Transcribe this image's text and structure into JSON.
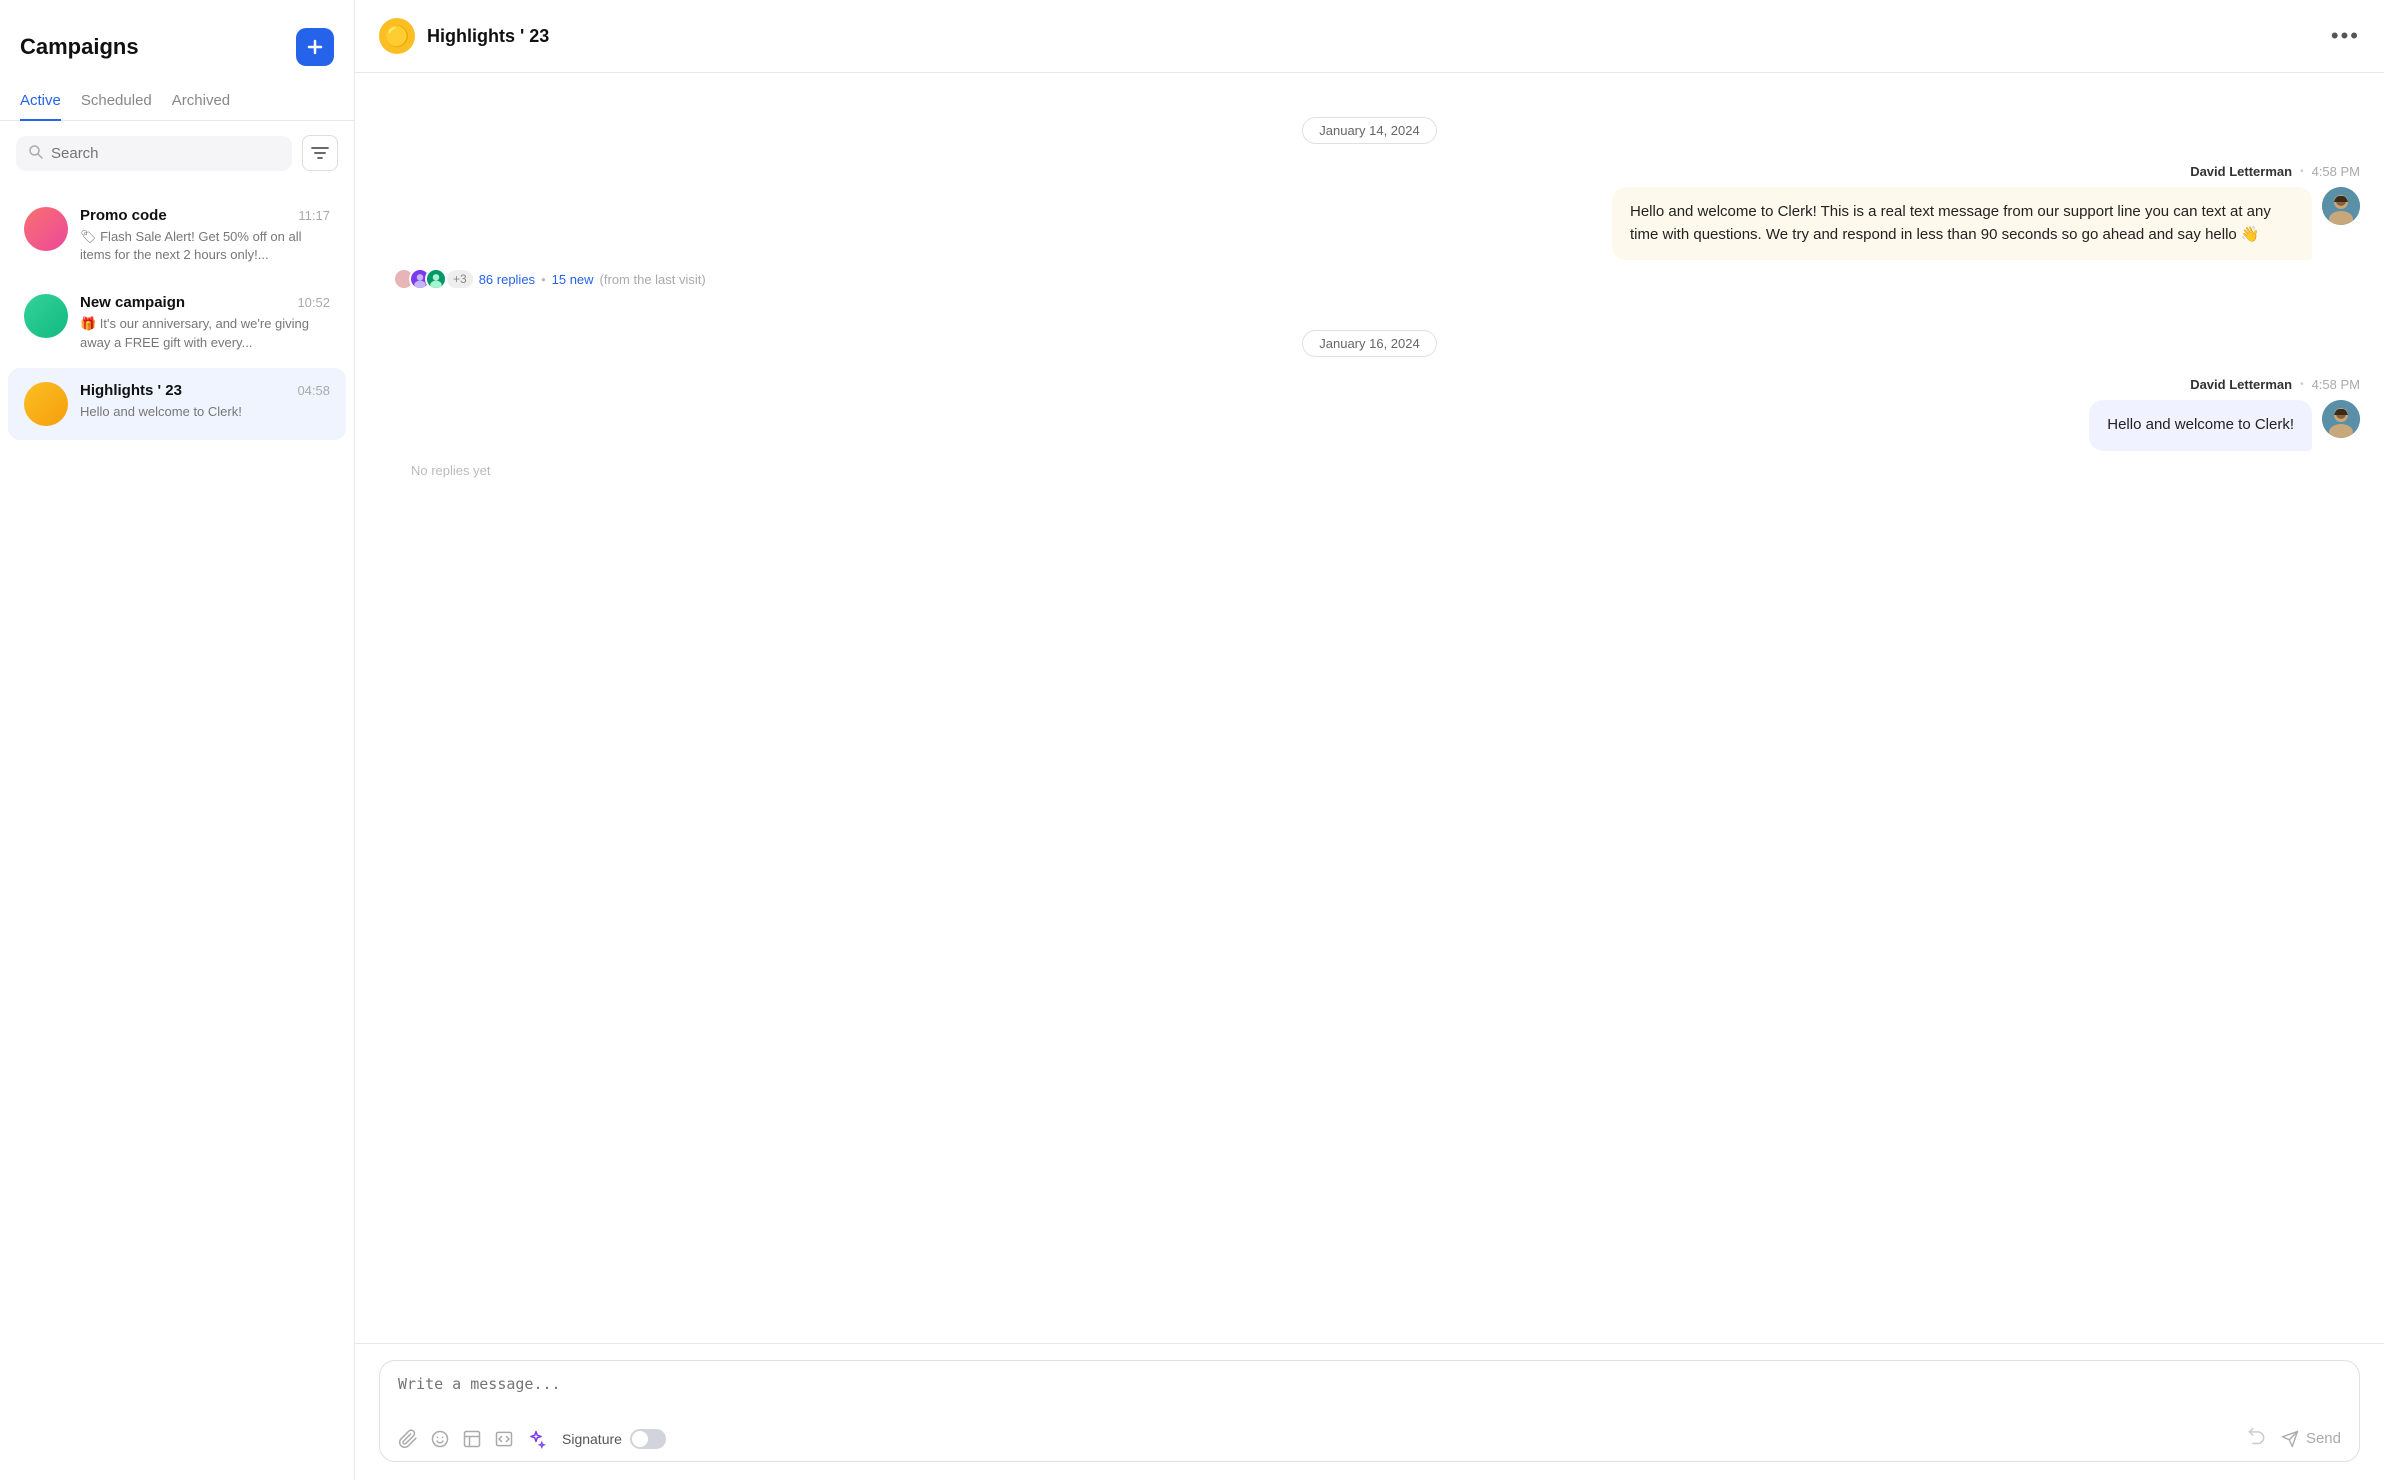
{
  "sidebar": {
    "title": "Campaigns",
    "add_label": "+",
    "tabs": [
      {
        "label": "Active",
        "active": true
      },
      {
        "label": "Scheduled",
        "active": false
      },
      {
        "label": "Archived",
        "active": false
      }
    ],
    "search_placeholder": "Search",
    "campaigns": [
      {
        "id": "promo",
        "name": "Promo code",
        "time": "11:17",
        "preview": "🏷 Flash Sale Alert! Get 50% off on all items for the next 2 hours only!...",
        "avatar_emoji": "",
        "avatar_class": "av-pink",
        "selected": false
      },
      {
        "id": "new",
        "name": "New campaign",
        "time": "10:52",
        "preview": "🎁 It's our anniversary, and we're giving away a FREE gift with every...",
        "avatar_emoji": "",
        "avatar_class": "av-green",
        "selected": false
      },
      {
        "id": "highlights",
        "name": "Highlights ' 23",
        "time": "04:58",
        "preview": "Hello and welcome to Clerk!",
        "avatar_emoji": "",
        "avatar_class": "av-yellow",
        "selected": true
      }
    ]
  },
  "main": {
    "channel_name": "Highlights ' 23",
    "channel_avatar_emoji": "🟡",
    "more_icon": "•••",
    "messages": [
      {
        "date": "January 14, 2024",
        "items": [
          {
            "sender": "David Letterman",
            "time": "4:58 PM",
            "text": "Hello and welcome to Clerk! This is a real text message from our support line you can text at any time with questions. We try and respond in less than 90 seconds so go ahead and say hello 👋",
            "replies_count": "86 replies",
            "replies_new": "15 new",
            "replies_from": "(from the last visit)",
            "reply_plus": "+3",
            "type": "inbound"
          }
        ]
      },
      {
        "date": "January 16, 2024",
        "items": [
          {
            "sender": "David Letterman",
            "time": "4:58 PM",
            "text": "Hello and welcome to Clerk!",
            "no_replies": "No replies yet",
            "type": "outbound"
          }
        ]
      }
    ],
    "compose": {
      "placeholder": "Write a message...",
      "signature_label": "Signature",
      "send_label": "Send"
    }
  }
}
